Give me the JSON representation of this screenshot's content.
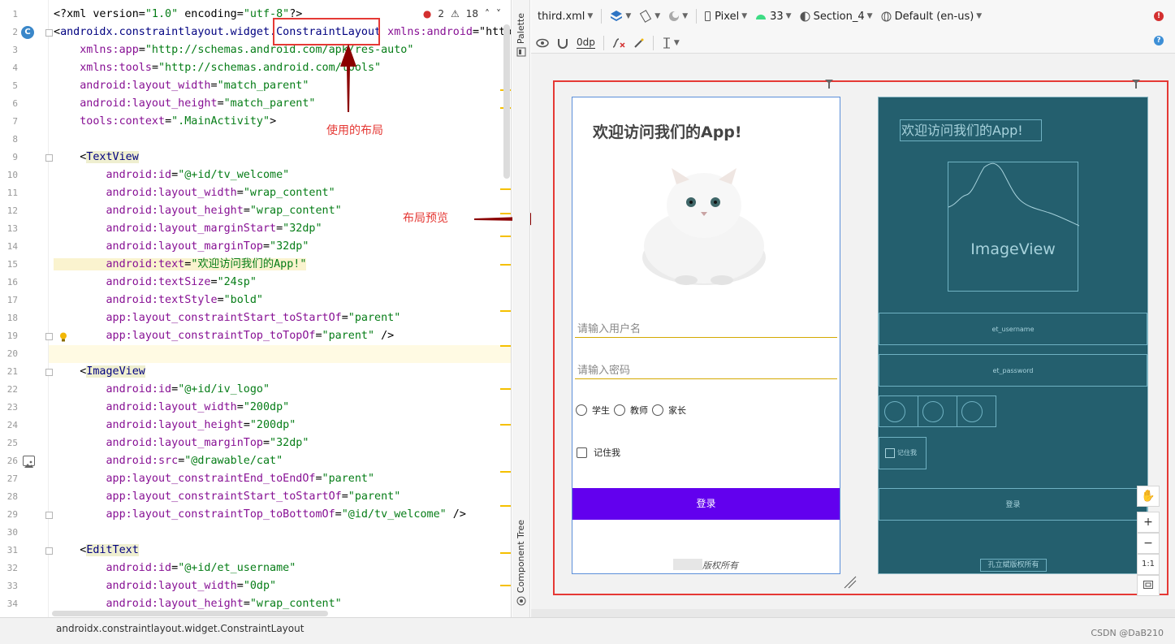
{
  "editor": {
    "status": {
      "errors": "2",
      "warnings": "18"
    },
    "lines": [
      {
        "n": "1",
        "t": "<?xml version=\"1.0\" encoding=\"utf-8\"?>"
      },
      {
        "n": "2",
        "t": "<androidx.constraintlayout.widget.ConstraintLayout xmlns:android=\"http:"
      },
      {
        "n": "3",
        "t": "    xmlns:app=\"http://schemas.android.com/apk/res-auto\""
      },
      {
        "n": "4",
        "t": "    xmlns:tools=\"http://schemas.android.com/tools\""
      },
      {
        "n": "5",
        "t": "    android:layout_width=\"match_parent\""
      },
      {
        "n": "6",
        "t": "    android:layout_height=\"match_parent\""
      },
      {
        "n": "7",
        "t": "    tools:context=\".MainActivity\">"
      },
      {
        "n": "8",
        "t": ""
      },
      {
        "n": "9",
        "t": "    <TextView"
      },
      {
        "n": "10",
        "t": "        android:id=\"@+id/tv_welcome\""
      },
      {
        "n": "11",
        "t": "        android:layout_width=\"wrap_content\""
      },
      {
        "n": "12",
        "t": "        android:layout_height=\"wrap_content\""
      },
      {
        "n": "13",
        "t": "        android:layout_marginStart=\"32dp\""
      },
      {
        "n": "14",
        "t": "        android:layout_marginTop=\"32dp\""
      },
      {
        "n": "15",
        "t": "        android:text=\"欢迎访问我们的App!\""
      },
      {
        "n": "16",
        "t": "        android:textSize=\"24sp\""
      },
      {
        "n": "17",
        "t": "        android:textStyle=\"bold\""
      },
      {
        "n": "18",
        "t": "        app:layout_constraintStart_toStartOf=\"parent\""
      },
      {
        "n": "19",
        "t": "        app:layout_constraintTop_toTopOf=\"parent\" />"
      },
      {
        "n": "20",
        "t": ""
      },
      {
        "n": "21",
        "t": "    <ImageView"
      },
      {
        "n": "22",
        "t": "        android:id=\"@+id/iv_logo\""
      },
      {
        "n": "23",
        "t": "        android:layout_width=\"200dp\""
      },
      {
        "n": "24",
        "t": "        android:layout_height=\"200dp\""
      },
      {
        "n": "25",
        "t": "        android:layout_marginTop=\"32dp\""
      },
      {
        "n": "26",
        "t": "        android:src=\"@drawable/cat\""
      },
      {
        "n": "27",
        "t": "        app:layout_constraintEnd_toEndOf=\"parent\""
      },
      {
        "n": "28",
        "t": "        app:layout_constraintStart_toStartOf=\"parent\""
      },
      {
        "n": "29",
        "t": "        app:layout_constraintTop_toBottomOf=\"@id/tv_welcome\" />"
      },
      {
        "n": "30",
        "t": ""
      },
      {
        "n": "31",
        "t": "    <EditText"
      },
      {
        "n": "32",
        "t": "        android:id=\"@+id/et_username\""
      },
      {
        "n": "33",
        "t": "        android:layout_width=\"0dp\""
      },
      {
        "n": "34",
        "t": "        android:layout_height=\"wrap_content\""
      }
    ]
  },
  "annotations": {
    "layout_used": "使用的布局",
    "layout_preview": "布局预览"
  },
  "side_strip": {
    "palette": "Palette",
    "component_tree": "Component Tree"
  },
  "toolbar": {
    "file": "third.xml",
    "device": "Pixel",
    "api": "33",
    "theme": "Section_4",
    "locale": "Default (en-us)",
    "margin": "0dp"
  },
  "preview": {
    "welcome": "欢迎访问我们的App!",
    "username_hint": "请输入用户名",
    "password_hint": "请输入密码",
    "radios": [
      "学生",
      "教师",
      "家长"
    ],
    "remember": "记住我",
    "login": "登录",
    "footer": "版权所有"
  },
  "blueprint": {
    "welcome": "欢迎访问我们的App!",
    "image": "ImageView",
    "et_username": "et_username",
    "et_password": "et_password",
    "remember": "记住我",
    "login": "登录",
    "footer": "孔立斌版权所有"
  },
  "zoom": {
    "fit": "1:1"
  },
  "statusbar": {
    "breadcrumb": "androidx.constraintlayout.widget.ConstraintLayout",
    "watermark": "CSDN @DaB210"
  }
}
